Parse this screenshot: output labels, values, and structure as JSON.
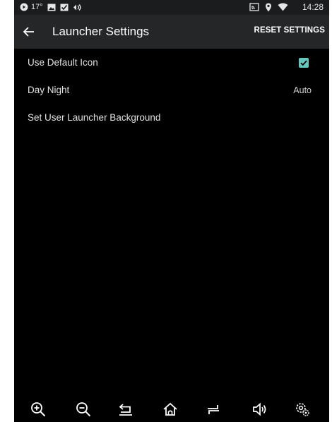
{
  "status_bar": {
    "temperature": "17°",
    "time": "14:28",
    "icons": [
      "app-notification-icon",
      "image-icon",
      "checkmark-message-icon",
      "signal-icon",
      "cast-icon",
      "location-icon",
      "wifi-icon"
    ]
  },
  "toolbar": {
    "title": "Launcher Settings",
    "reset_label": "RESET SETTINGS",
    "back_icon": "back-arrow-icon"
  },
  "settings": {
    "items": [
      {
        "label": "Use Default Icon",
        "checked": true
      },
      {
        "label": "Day Night",
        "value": "Auto"
      },
      {
        "label": "Set User Launcher Background"
      }
    ]
  },
  "nav_bar": {
    "icons": [
      "zoom-in-icon",
      "zoom-out-icon",
      "back-icon",
      "home-icon",
      "recents-icon",
      "volume-icon",
      "settings-icon"
    ]
  },
  "colors": {
    "background": "#000000",
    "toolbar": "#252628",
    "status_bar": "#1b1c1e",
    "accent": "#66c7bd",
    "text_primary": "#e0e0e0"
  }
}
